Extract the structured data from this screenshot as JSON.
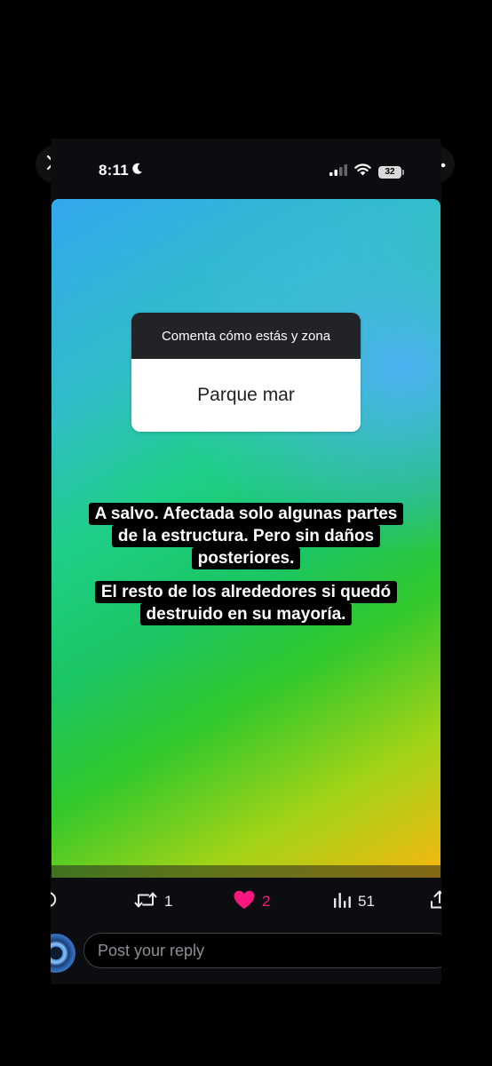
{
  "status_bar": {
    "time": "8:11",
    "battery": "32"
  },
  "story": {
    "question_prompt": "Comenta cómo estás y zona",
    "question_answer": "Parque mar",
    "caption_paragraph_1": [
      "A salvo. Afectada solo algunas partes",
      "de la estructura. Pero sin daños",
      "posteriores."
    ],
    "caption_paragraph_2": [
      "El resto de los alrededores si quedó",
      "destruido en su mayoría."
    ]
  },
  "actions": {
    "retweet_count": "1",
    "like_count": "2",
    "views_count": "51"
  },
  "composer": {
    "placeholder": "Post your reply"
  },
  "colors": {
    "like_active": "#f91880",
    "background": "#000000"
  },
  "icons": [
    "close-icon",
    "more-icon",
    "moon-icon",
    "signal-icon",
    "wifi-icon",
    "battery-icon",
    "reply-icon",
    "retweet-icon",
    "heart-icon",
    "views-icon",
    "share-icon"
  ]
}
